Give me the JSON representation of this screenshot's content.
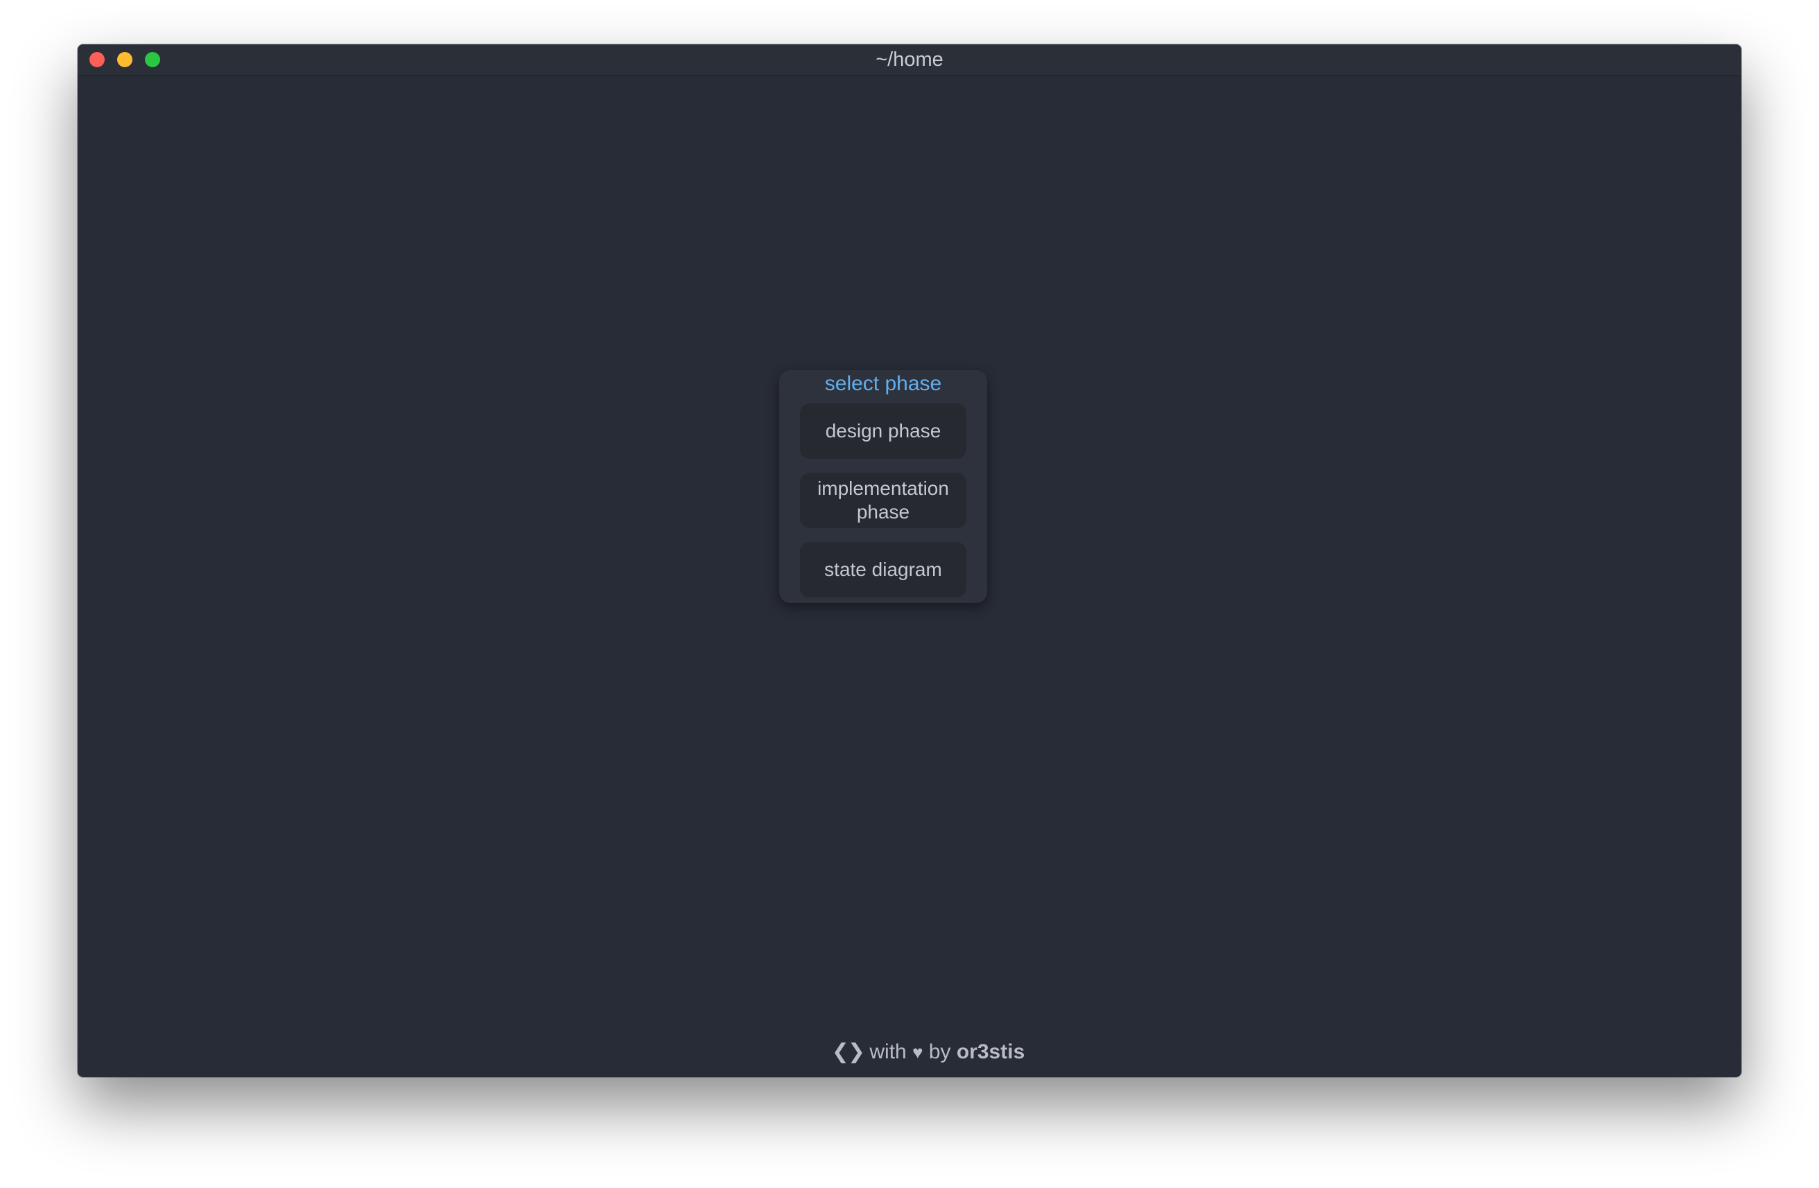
{
  "window": {
    "title": "~/home"
  },
  "menu": {
    "heading": "select phase",
    "items": [
      {
        "label": "design phase"
      },
      {
        "label": "implementation phase"
      },
      {
        "label": "state diagram"
      }
    ]
  },
  "footer": {
    "code_glyph": "❮❯",
    "with_text": "with",
    "heart_glyph": "♥",
    "by_text": "by",
    "author": "or3stis"
  },
  "colors": {
    "window_bg": "#282c36",
    "heading_accent": "#61afef",
    "close": "#fe5f57",
    "minimize": "#febc2e",
    "maximize": "#28c840"
  }
}
